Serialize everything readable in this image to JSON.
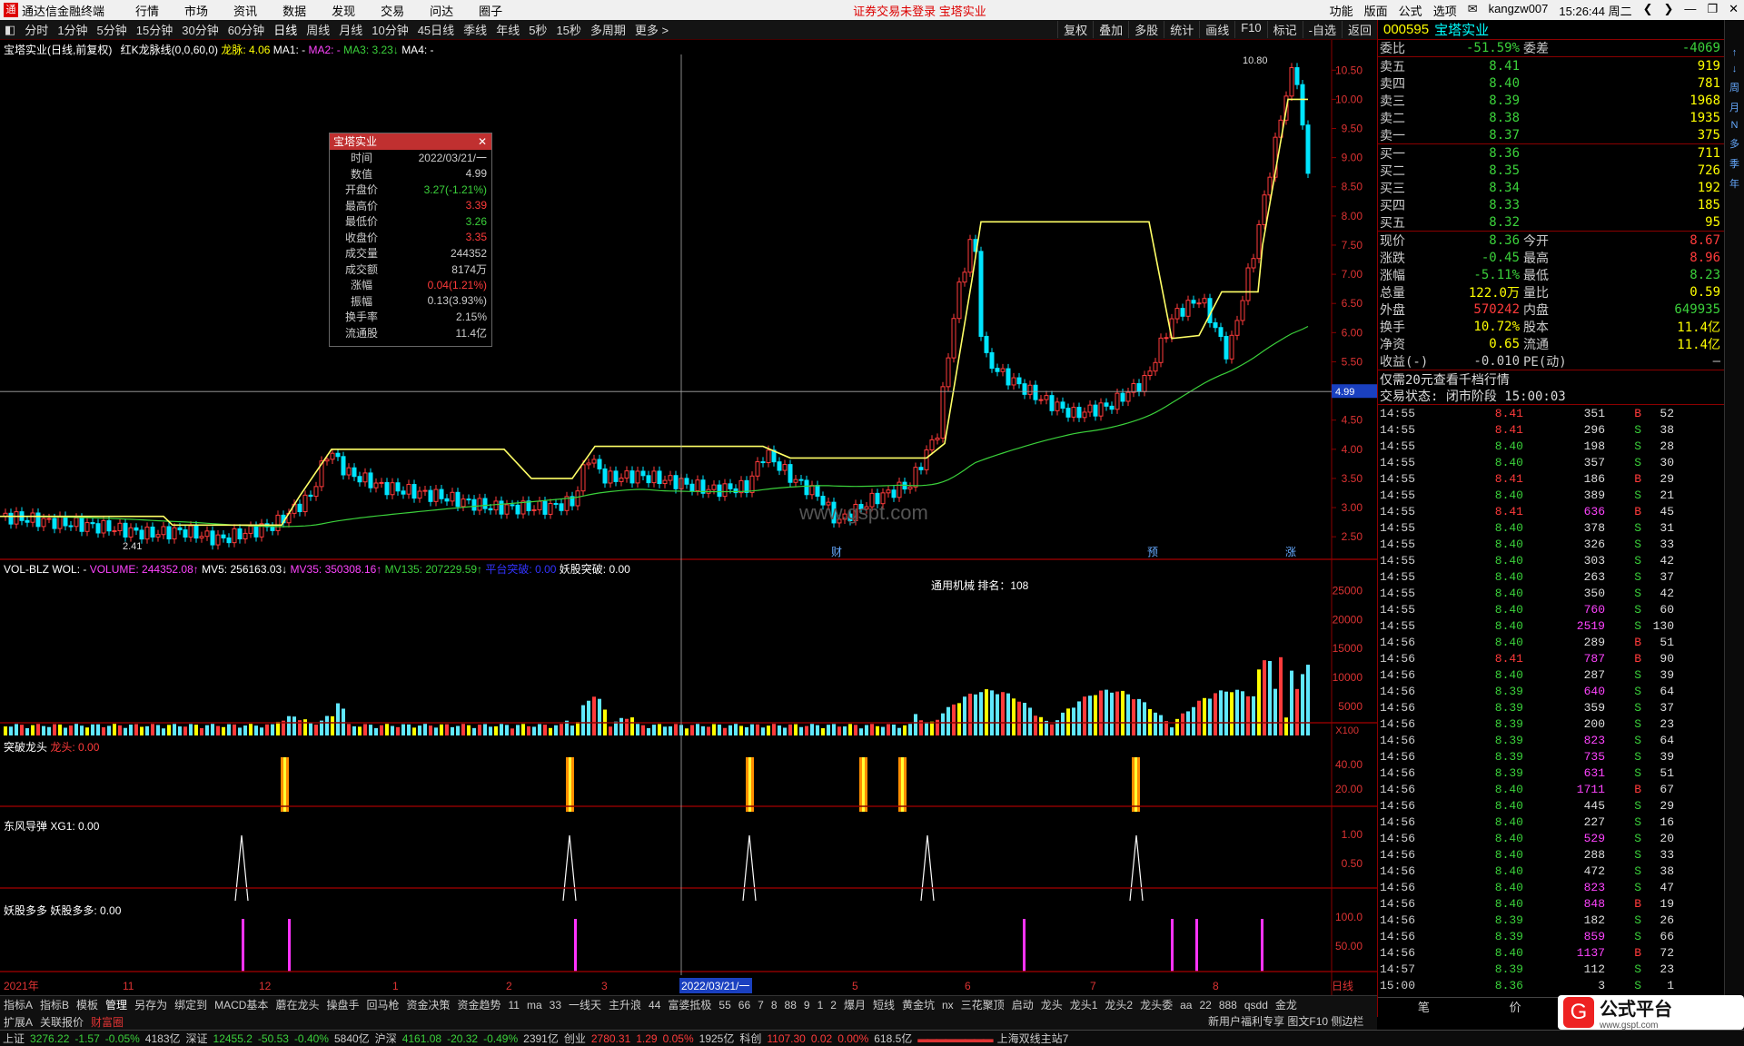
{
  "app": {
    "title": "通达信金融终端",
    "menus": [
      "行情",
      "市场",
      "资讯",
      "数据",
      "发现",
      "交易",
      "问达",
      "圈子"
    ],
    "warning": "证券交易未登录  宝塔实业",
    "right": [
      "功能",
      "版面",
      "公式",
      "选项",
      "kangzw007",
      "15:26:44 周二"
    ]
  },
  "periods": [
    "分时",
    "1分钟",
    "5分钟",
    "15分钟",
    "30分钟",
    "60分钟",
    "日线",
    "周线",
    "月线",
    "10分钟",
    "45日线",
    "季线",
    "年线",
    "5秒",
    "15秒",
    "多周期",
    "更多 >"
  ],
  "tools": [
    "复权",
    "叠加",
    "多股",
    "统计",
    "画线",
    "F10",
    "标记",
    "-自选",
    "返回"
  ],
  "main": {
    "title": "宝塔实业(日线,前复权)",
    "indicator": "红K龙脉线(0,0,60,0)",
    "longmai": "龙脉: 4.06",
    "ma1": "MA1: -",
    "ma2": "MA2: -",
    "ma3": "MA3: 3.23↓",
    "ma4": "MA4: -",
    "watermark": "www.gspt.com",
    "high_label": "10.80",
    "low_label": "2.41",
    "crosshair_price": "4.99",
    "price_axis": [
      "10.50",
      "10.00",
      "9.50",
      "9.00",
      "8.50",
      "8.00",
      "7.50",
      "7.00",
      "6.50",
      "6.00",
      "5.50",
      "5.00",
      "4.50",
      "4.00",
      "3.50",
      "3.00",
      "2.50"
    ],
    "markers": [
      "财",
      "预",
      "涨"
    ]
  },
  "popup": {
    "title": "宝塔实业",
    "rows": [
      {
        "k": "时间",
        "v": "2022/03/21/一",
        "c": "#ccc"
      },
      {
        "k": "数值",
        "v": "4.99",
        "c": "#ccc"
      },
      {
        "k": "开盘价",
        "v": "3.27(-1.21%)",
        "c": "#3bd13b"
      },
      {
        "k": "最高价",
        "v": "3.39",
        "c": "#ff3b3b"
      },
      {
        "k": "最低价",
        "v": "3.26",
        "c": "#3bd13b"
      },
      {
        "k": "收盘价",
        "v": "3.35",
        "c": "#ff3b3b"
      },
      {
        "k": "成交量",
        "v": "244352",
        "c": "#ccc"
      },
      {
        "k": "成交额",
        "v": "8174万",
        "c": "#ccc"
      },
      {
        "k": "涨幅",
        "v": "0.04(1.21%)",
        "c": "#ff3b3b"
      },
      {
        "k": "振幅",
        "v": "0.13(3.93%)",
        "c": "#ccc"
      },
      {
        "k": "换手率",
        "v": "2.15%",
        "c": "#ccc"
      },
      {
        "k": "流通股",
        "v": "11.4亿",
        "c": "#ccc"
      }
    ]
  },
  "vol": {
    "name": "VOL-BLZ",
    "wol": "WOL: -",
    "volume": "VOLUME: 244352.08↑",
    "mv5": "MV5: 256163.03↓",
    "mv35": "MV35: 350308.16↑",
    "mv135": "MV135: 207229.59↑",
    "platform": "平台突破: 0.00",
    "yaogu": "妖股突破: 0.00",
    "sector": "通用机械    排名：108",
    "axis": [
      "25000",
      "20000",
      "15000",
      "10000",
      "5000"
    ],
    "unit": "X100"
  },
  "ind1": {
    "name": "突破龙头",
    "label": "龙头: 0.00",
    "axis": [
      "40.00",
      "20.00"
    ]
  },
  "ind2": {
    "name": "东风导弹",
    "label": "XG1: 0.00",
    "axis": [
      "1.00",
      "0.50"
    ]
  },
  "ind3": {
    "name": "妖股多多",
    "label": "妖股多多: 0.00",
    "axis": [
      "100.0",
      "50.00"
    ]
  },
  "dates": [
    "2021年",
    "11",
    "12",
    "1",
    "2",
    "3",
    "2022/03/21/一",
    "5",
    "6",
    "7",
    "8",
    "日线"
  ],
  "tabs": [
    "指标A",
    "指标B",
    "模板",
    "管理",
    "另存为",
    "绑定到",
    "MACD基本",
    "蘑在龙头",
    "操盘手",
    "回马枪",
    "资金决策",
    "资金趋势",
    "11",
    "ma",
    "33",
    "一线天",
    "主升浪",
    "44",
    "富婆抵极",
    "55",
    "66",
    "7",
    "8",
    "88",
    "9",
    "1",
    "2",
    "爆月",
    "短线",
    "黄金坑",
    "nx",
    "三花聚顶",
    "启动",
    "龙头",
    "龙头1",
    "龙头2",
    "龙头委",
    "aa",
    "22",
    "888",
    "qsdd",
    "金龙"
  ],
  "tabs2": [
    "扩展A",
    "关联报价",
    "财富圈"
  ],
  "quote": {
    "code": "000595",
    "name": "宝塔实业",
    "weibi": "委比",
    "weibi_v": "-51.59%",
    "weicha": "委差",
    "weicha_v": "-4069",
    "asks": [
      {
        "l": "卖五",
        "p": "8.41",
        "v": "919"
      },
      {
        "l": "卖四",
        "p": "8.40",
        "v": "781"
      },
      {
        "l": "卖三",
        "p": "8.39",
        "v": "1968"
      },
      {
        "l": "卖二",
        "p": "8.38",
        "v": "1935"
      },
      {
        "l": "卖一",
        "p": "8.37",
        "v": "375"
      }
    ],
    "bids": [
      {
        "l": "买一",
        "p": "8.36",
        "v": "711"
      },
      {
        "l": "买二",
        "p": "8.35",
        "v": "726"
      },
      {
        "l": "买三",
        "p": "8.34",
        "v": "192"
      },
      {
        "l": "买四",
        "p": "8.33",
        "v": "185"
      },
      {
        "l": "买五",
        "p": "8.32",
        "v": "95"
      }
    ],
    "stats": [
      {
        "a": "现价",
        "av": "8.36",
        "ac": "#3bd13b",
        "b": "今开",
        "bv": "8.67",
        "bc": "#ff3b3b"
      },
      {
        "a": "涨跌",
        "av": "-0.45",
        "ac": "#3bd13b",
        "b": "最高",
        "bv": "8.96",
        "bc": "#ff3b3b"
      },
      {
        "a": "涨幅",
        "av": "-5.11%",
        "ac": "#3bd13b",
        "b": "最低",
        "bv": "8.23",
        "bc": "#3bd13b"
      },
      {
        "a": "总量",
        "av": "122.0万",
        "ac": "#ffff00",
        "b": "量比",
        "bv": "0.59",
        "bc": "#ffff00"
      },
      {
        "a": "外盘",
        "av": "570242",
        "ac": "#ff3b3b",
        "b": "内盘",
        "bv": "649935",
        "bc": "#3bd13b"
      },
      {
        "a": "换手",
        "av": "10.72%",
        "ac": "#ffff00",
        "b": "股本",
        "bv": "11.4亿",
        "bc": "#ffff00"
      },
      {
        "a": "净资",
        "av": "0.65",
        "ac": "#ffff00",
        "b": "流通",
        "bv": "11.4亿",
        "bc": "#ffff00"
      },
      {
        "a": "收益(-)",
        "av": "-0.010",
        "ac": "#ccc",
        "b": "PE(动)",
        "bv": "–",
        "bc": "#ccc"
      }
    ],
    "promo": "仅需20元查看千档行情",
    "state": "交易状态: 闭市阶段 15:00:03"
  },
  "ticks": [
    [
      "14:55",
      "8.41",
      "351",
      "B",
      "52"
    ],
    [
      "14:55",
      "8.41",
      "296",
      "S",
      "38"
    ],
    [
      "14:55",
      "8.40",
      "198",
      "S",
      "28"
    ],
    [
      "14:55",
      "8.40",
      "357",
      "S",
      "30"
    ],
    [
      "14:55",
      "8.41",
      "186",
      "B",
      "29"
    ],
    [
      "14:55",
      "8.40",
      "389",
      "S",
      "21"
    ],
    [
      "14:55",
      "8.41",
      "636",
      "B",
      "45"
    ],
    [
      "14:55",
      "8.40",
      "378",
      "S",
      "31"
    ],
    [
      "14:55",
      "8.40",
      "326",
      "S",
      "33"
    ],
    [
      "14:55",
      "8.40",
      "303",
      "S",
      "42"
    ],
    [
      "14:55",
      "8.40",
      "263",
      "S",
      "37"
    ],
    [
      "14:55",
      "8.40",
      "350",
      "S",
      "42"
    ],
    [
      "14:55",
      "8.40",
      "760",
      "S",
      "60"
    ],
    [
      "14:55",
      "8.40",
      "2519",
      "S",
      "130"
    ],
    [
      "14:56",
      "8.40",
      "289",
      "B",
      "51"
    ],
    [
      "14:56",
      "8.41",
      "787",
      "B",
      "90"
    ],
    [
      "14:56",
      "8.40",
      "287",
      "S",
      "39"
    ],
    [
      "14:56",
      "8.39",
      "640",
      "S",
      "64"
    ],
    [
      "14:56",
      "8.39",
      "359",
      "S",
      "37"
    ],
    [
      "14:56",
      "8.39",
      "200",
      "S",
      "23"
    ],
    [
      "14:56",
      "8.39",
      "823",
      "S",
      "64"
    ],
    [
      "14:56",
      "8.39",
      "735",
      "S",
      "39"
    ],
    [
      "14:56",
      "8.39",
      "631",
      "S",
      "51"
    ],
    [
      "14:56",
      "8.40",
      "1711",
      "B",
      "67"
    ],
    [
      "14:56",
      "8.40",
      "445",
      "S",
      "29"
    ],
    [
      "14:56",
      "8.40",
      "227",
      "S",
      "16"
    ],
    [
      "14:56",
      "8.40",
      "529",
      "S",
      "20"
    ],
    [
      "14:56",
      "8.40",
      "288",
      "S",
      "33"
    ],
    [
      "14:56",
      "8.40",
      "472",
      "S",
      "38"
    ],
    [
      "14:56",
      "8.40",
      "823",
      "S",
      "47"
    ],
    [
      "14:56",
      "8.40",
      "848",
      "B",
      "19"
    ],
    [
      "14:56",
      "8.39",
      "182",
      "S",
      "26"
    ],
    [
      "14:56",
      "8.39",
      "859",
      "S",
      "66"
    ],
    [
      "14:56",
      "8.40",
      "1137",
      "B",
      "72"
    ],
    [
      "14:57",
      "8.39",
      "112",
      "S",
      "23"
    ],
    [
      "15:00",
      "8.36",
      "3",
      "S",
      "1"
    ]
  ],
  "rp_tabs": [
    "笔",
    "价",
    "细",
    "势"
  ],
  "side_icons": [
    "↑",
    "↓",
    "周",
    "月",
    "N",
    "多",
    "季",
    "年"
  ],
  "status": {
    "sh": "上证",
    "sh_v": "3276.22",
    "sh_c": "-1.57",
    "sh_p": "-0.05%",
    "sh_a": "4183亿",
    "sz": "深证",
    "sz_v": "12455.2",
    "sz_c": "-50.53",
    "sz_p": "-0.40%",
    "sz_a": "5840亿",
    "hs": "沪深",
    "hs_v": "4161.08",
    "hs_c": "-20.32",
    "hs_p": "-0.49%",
    "hs_a": "2391亿",
    "cy": "创业",
    "cy_v": "2780.31",
    "cy_c": "1.29",
    "cy_p": "0.05%",
    "cy_a": "1925亿",
    "kc": "科创",
    "kc_v": "1107.30",
    "kc_c": "0.02",
    "kc_p": "0.00%",
    "kc_a": "618.5亿",
    "server": "上海双线主站7",
    "newuser": "新用户福利专享",
    "f10": "图文F10",
    "side": "侧边栏"
  },
  "brand": "公式平台",
  "brand_url": "www.gspt.com",
  "chart_data": {
    "type": "candlestick",
    "title": "宝塔实业(日线,前复权)",
    "ylim": [
      2.3,
      10.8
    ],
    "key_points": [
      {
        "label": "low",
        "value": 2.41
      },
      {
        "label": "high",
        "value": 10.8
      },
      {
        "label": "2022/03/21 close",
        "value": 3.35
      },
      {
        "label": "last close",
        "value": 8.36
      }
    ]
  }
}
